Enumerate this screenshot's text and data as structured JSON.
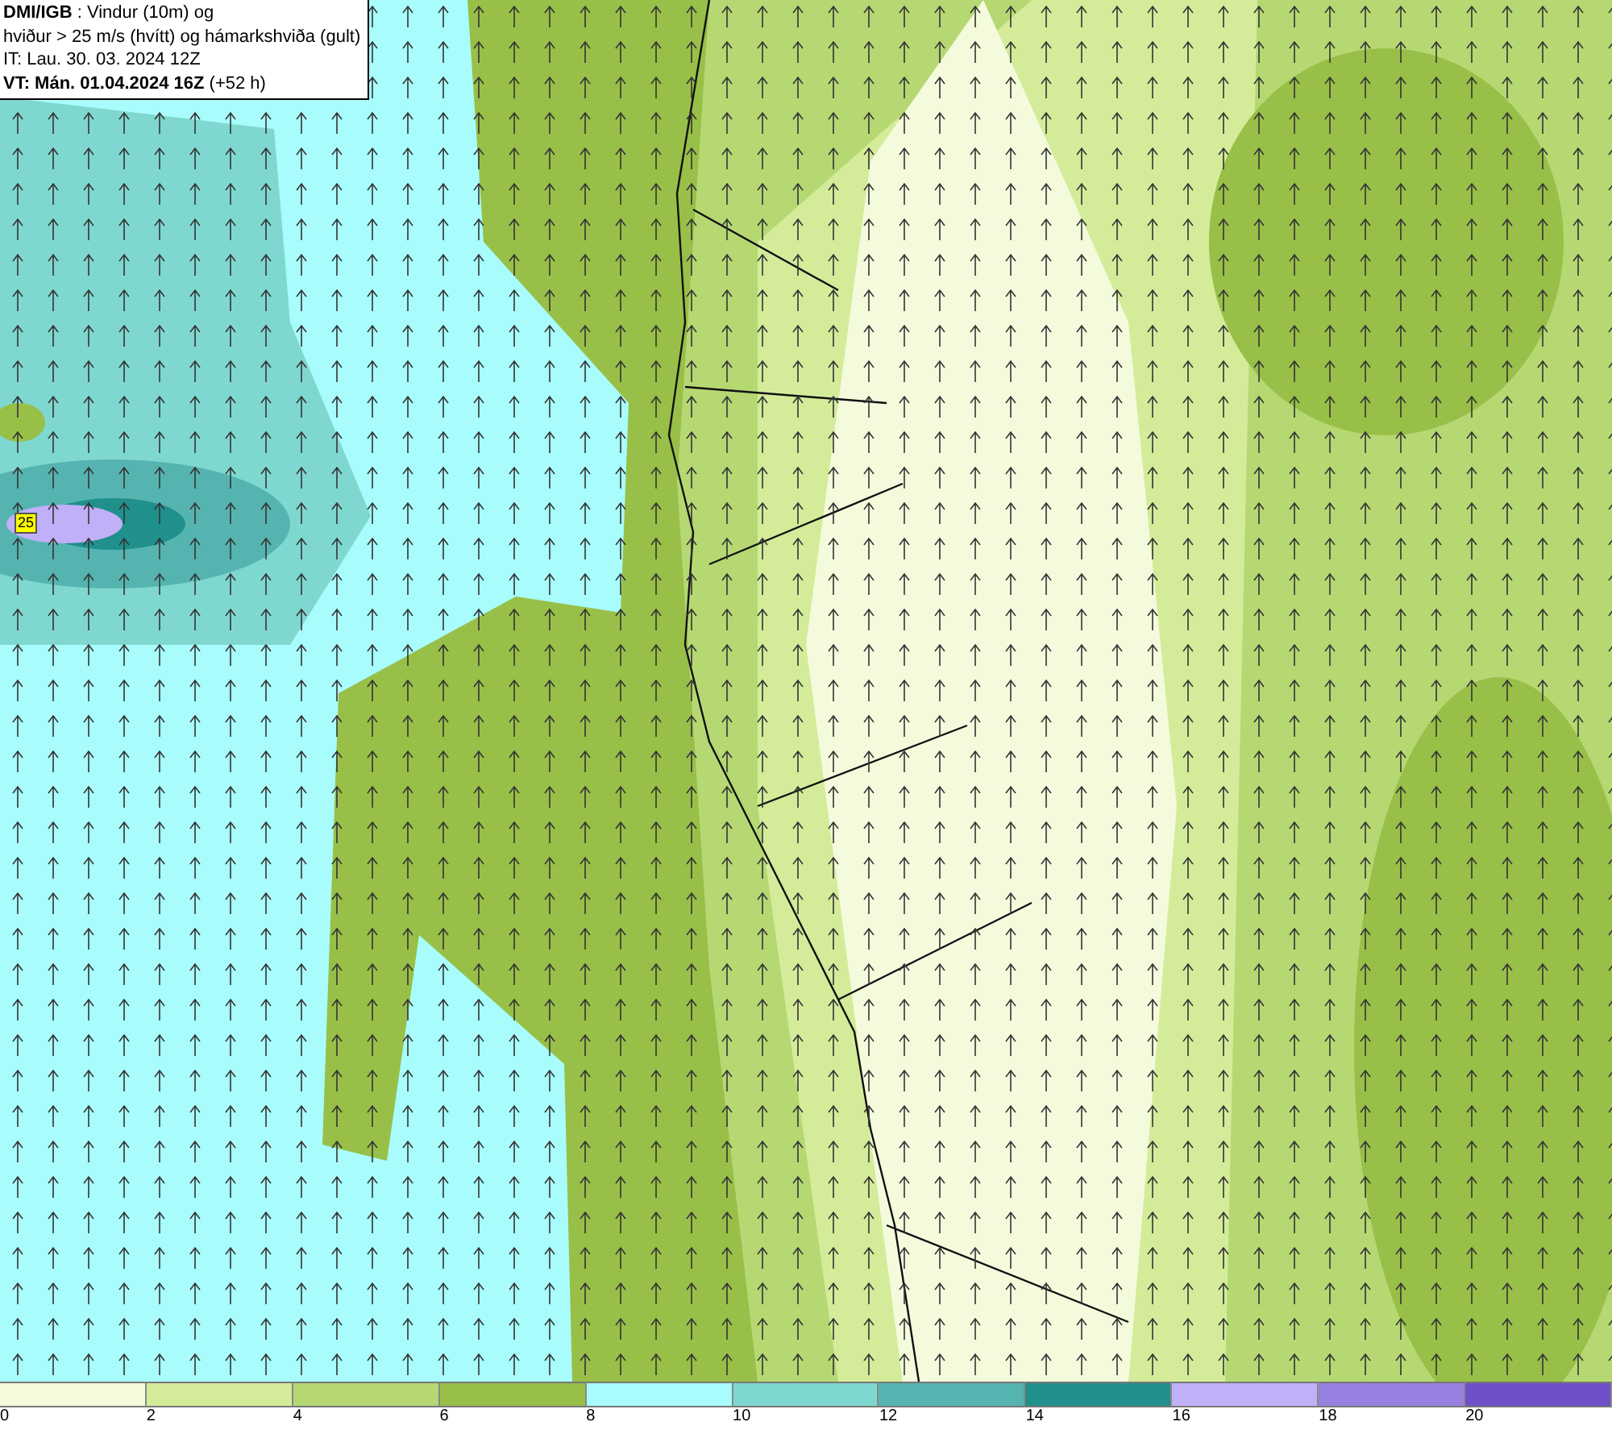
{
  "header": {
    "line_1": "**DMI/IGB** : Vindur (10m) og",
    "line_2": "hviður > 25 m/s (hvítt) og hámarkshviða (gult)",
    "line_3": "IT: Lau. 30. 03. 2024 12Z",
    "line_4": "**VT: Mán. 01.04.2024 16Z** (+52 h)"
  },
  "map": {
    "gust_labels": [
      {
        "value": "25"
      }
    ]
  },
  "legend": {
    "bins": [
      {
        "label": "0",
        "color": "#f4fbdc"
      },
      {
        "label": "2",
        "color": "#d4ec9a"
      },
      {
        "label": "4",
        "color": "#b5d873"
      },
      {
        "label": "6",
        "color": "#98bf48"
      },
      {
        "label": "8",
        "color": "#a8fcfc"
      },
      {
        "label": "10",
        "color": "#7fd8d0"
      },
      {
        "label": "12",
        "color": "#56b4b0"
      },
      {
        "label": "14",
        "color": "#20908c"
      },
      {
        "label": "16",
        "color": "#c0b0f8"
      },
      {
        "label": "18",
        "color": "#9880e0"
      },
      {
        "label": "20",
        "color": "#7050c8"
      }
    ]
  }
}
